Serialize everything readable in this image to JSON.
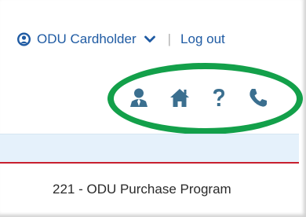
{
  "header": {
    "user_menu_label": "ODU Cardholder",
    "separator": "|",
    "logout_label": "Log out"
  },
  "toolbar": {
    "icons": [
      "person-icon",
      "home-icon",
      "help-icon",
      "phone-icon"
    ]
  },
  "program": {
    "label": "221 - ODU Purchase Program"
  },
  "colors": {
    "link": "#1f5ba3",
    "icon": "#3b6f8f",
    "highlight": "#13a04a",
    "band": "#e5f1fb",
    "accent_line": "#c8202f"
  }
}
